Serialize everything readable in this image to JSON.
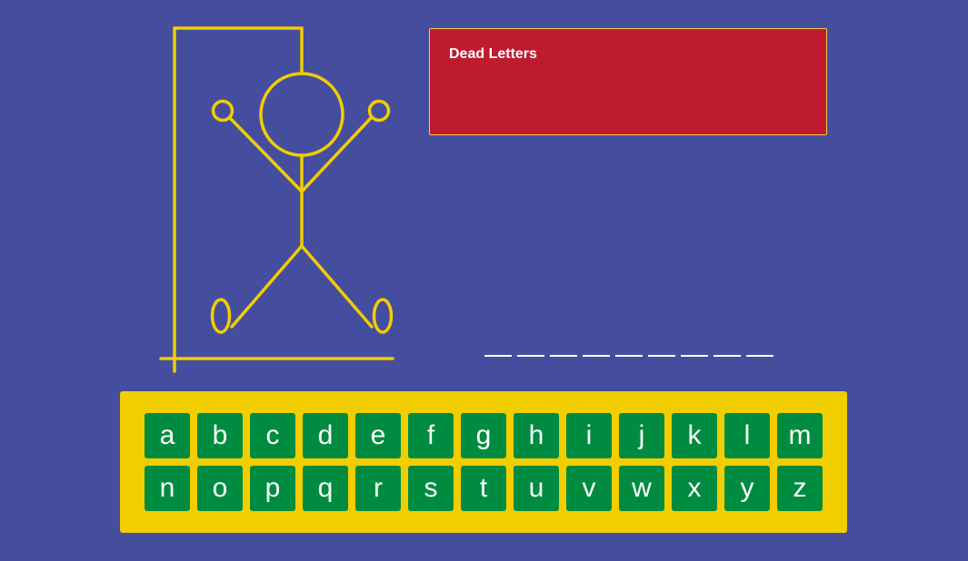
{
  "dead_letters": {
    "title": "Dead Letters",
    "letters": ""
  },
  "word": {
    "slots": [
      "",
      "",
      "",
      "",
      "",
      "",
      "",
      "",
      ""
    ]
  },
  "keyboard": {
    "row1": [
      "a",
      "b",
      "c",
      "d",
      "e",
      "f",
      "g",
      "h",
      "i",
      "j",
      "k",
      "l",
      "m"
    ],
    "row2": [
      "n",
      "o",
      "p",
      "q",
      "r",
      "s",
      "t",
      "u",
      "v",
      "w",
      "x",
      "y",
      "z"
    ]
  },
  "colors": {
    "background": "#454e9e",
    "gallows": "#f2cd00",
    "dead_panel": "#be1b2f",
    "keyboard_panel": "#f2cd00",
    "key": "#008c40"
  }
}
